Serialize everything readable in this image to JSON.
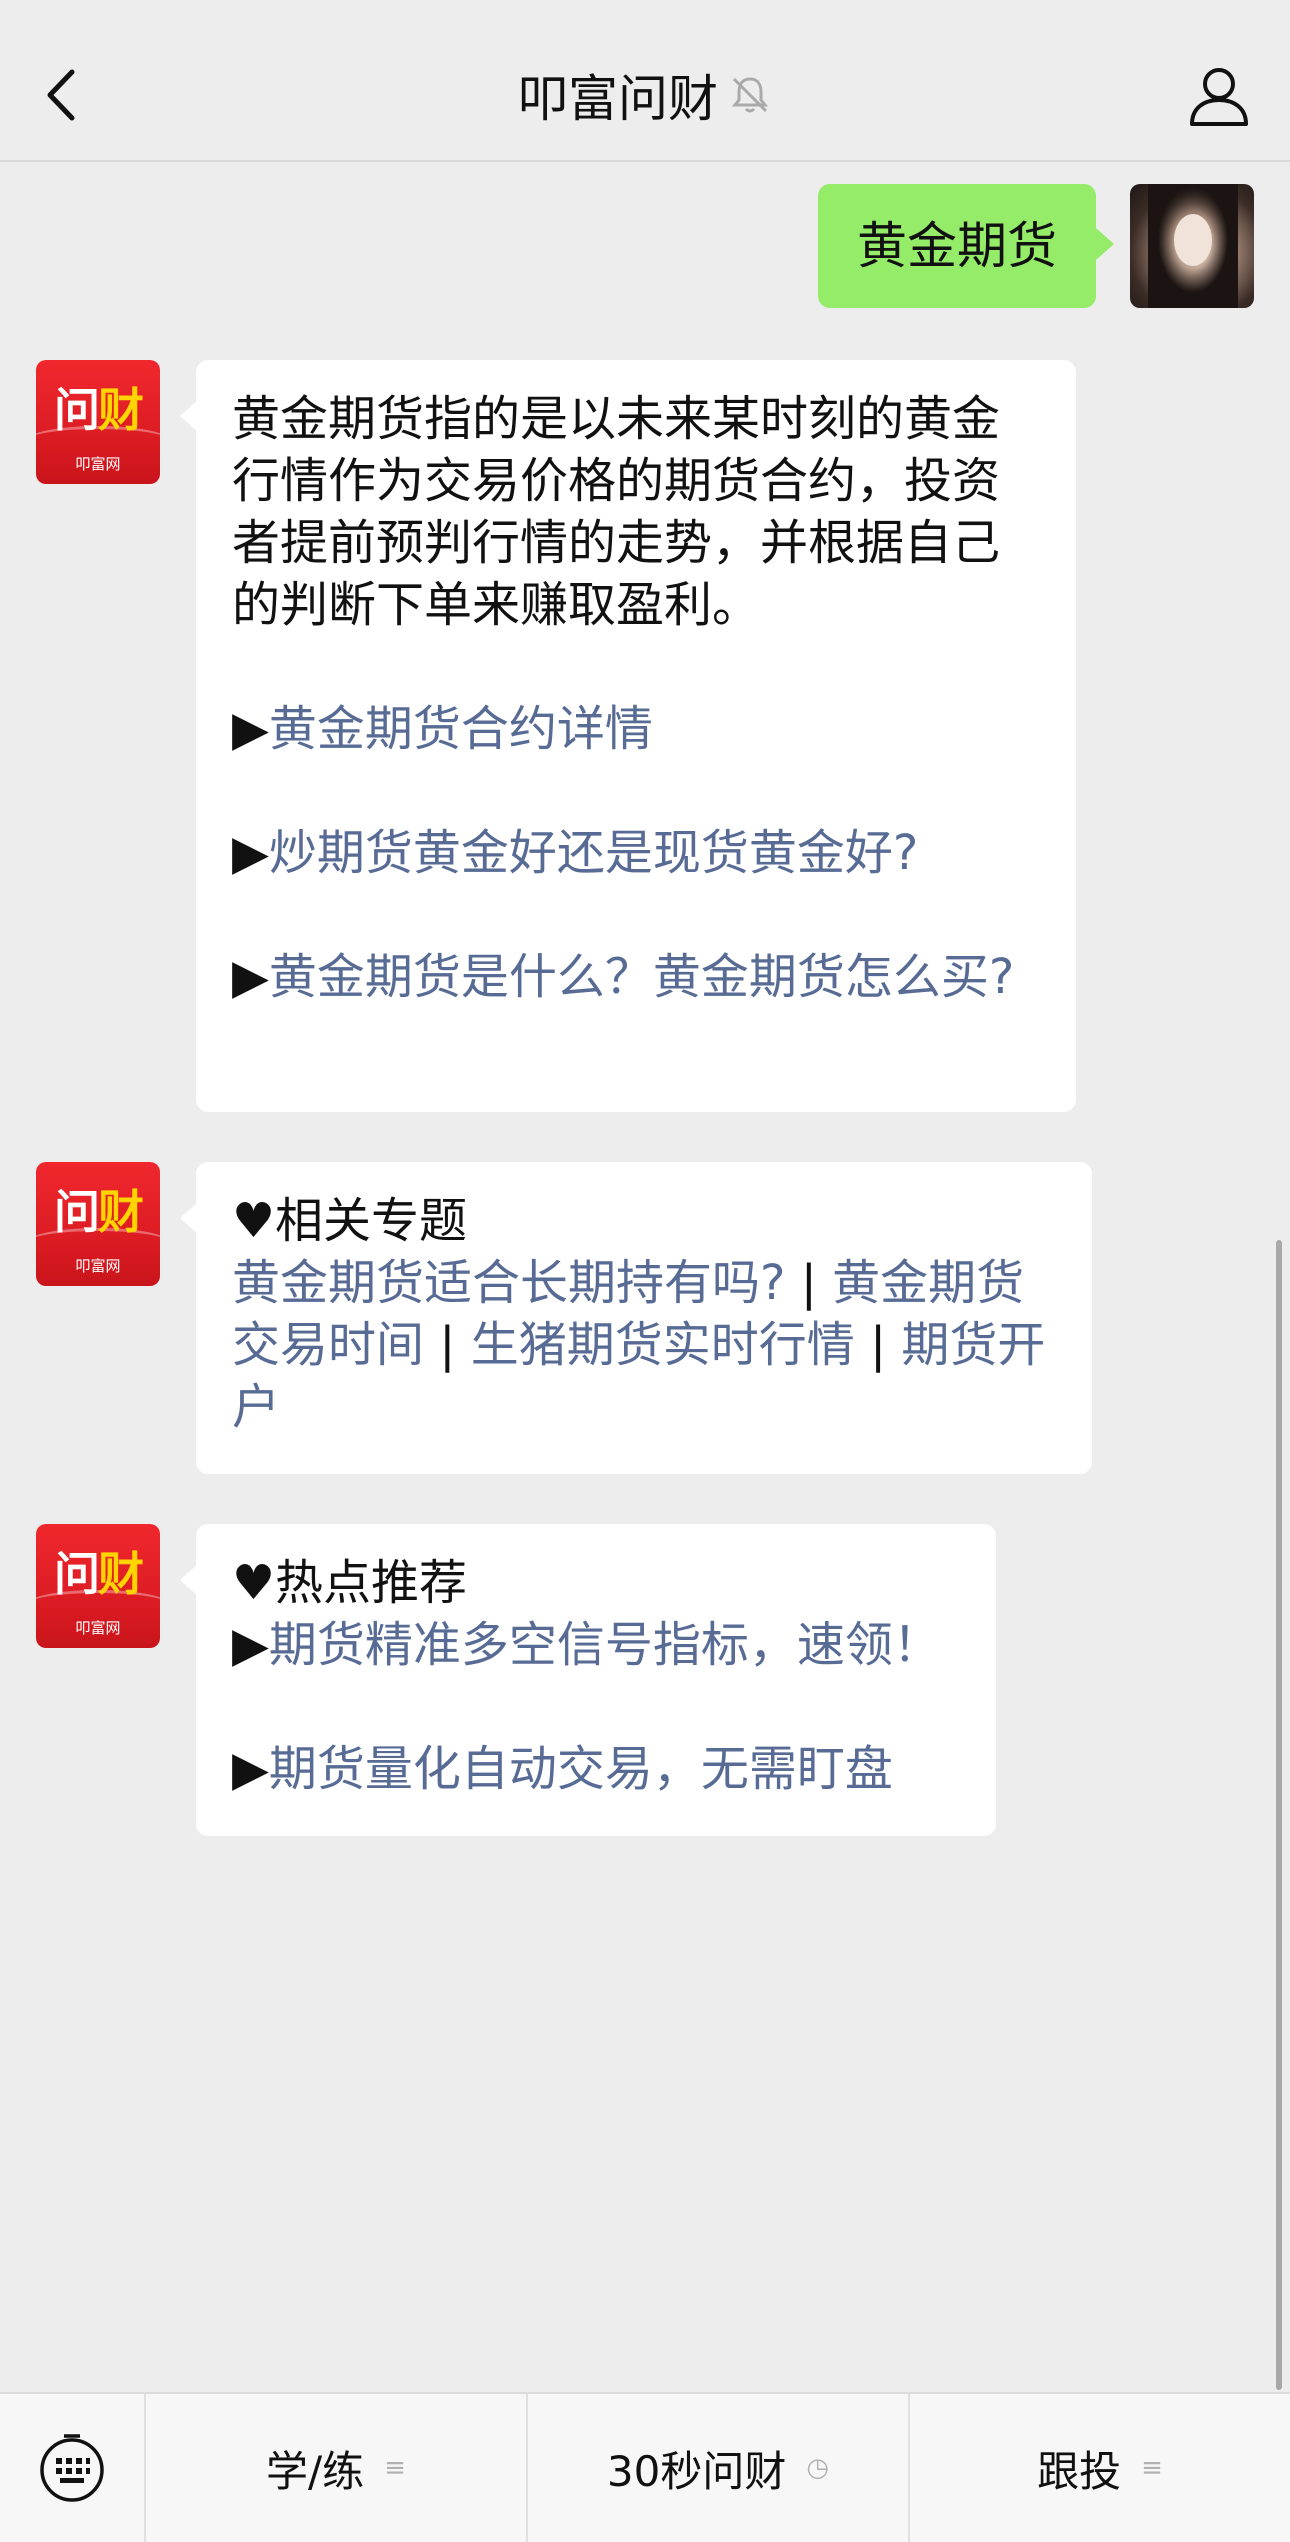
{
  "header": {
    "title": "叩富问财",
    "back_icon": "chevron-left-icon",
    "mute_icon": "bell-muted-icon",
    "profile_icon": "person-icon"
  },
  "user_message": {
    "text": "黄金期货"
  },
  "bot_avatar": {
    "logo_part1": "问",
    "logo_part2": "财",
    "logo_sub": "叩富网"
  },
  "message1": {
    "intro": "黄金期货指的是以未来某时刻的黄金行情作为交易价格的期货合约，投资者提前预判行情的走势，并根据自己的判断下单来赚取盈利。",
    "arrow": "▶",
    "links": [
      "黄金期货合约详情",
      "炒期货黄金好还是现货黄金好?",
      "黄金期货是什么？黄金期货怎么买?"
    ]
  },
  "message2": {
    "heading": "♥相关专题",
    "link1": "黄金期货适合长期持有吗?",
    "sep": " | ",
    "link2": "黄金期货交易时间",
    "link3": "生猪期货实时行情",
    "link4": "期货开户"
  },
  "message3": {
    "heading": "♥热点推荐",
    "arrow": "▶",
    "links": [
      "期货精准多空信号指标，速领！",
      "期货量化自动交易，无需盯盘"
    ]
  },
  "bottom_menu": {
    "keyboard_icon": "keyboard-icon",
    "items": [
      {
        "label": "学/练",
        "suffix": "≡"
      },
      {
        "label": "30秒问财",
        "suffix": "◷"
      },
      {
        "label": "跟投",
        "suffix": "≡"
      }
    ]
  },
  "colors": {
    "background": "#ededed",
    "user_bubble": "#95ec69",
    "link": "#576b95",
    "brand_red": "#e3242b"
  }
}
